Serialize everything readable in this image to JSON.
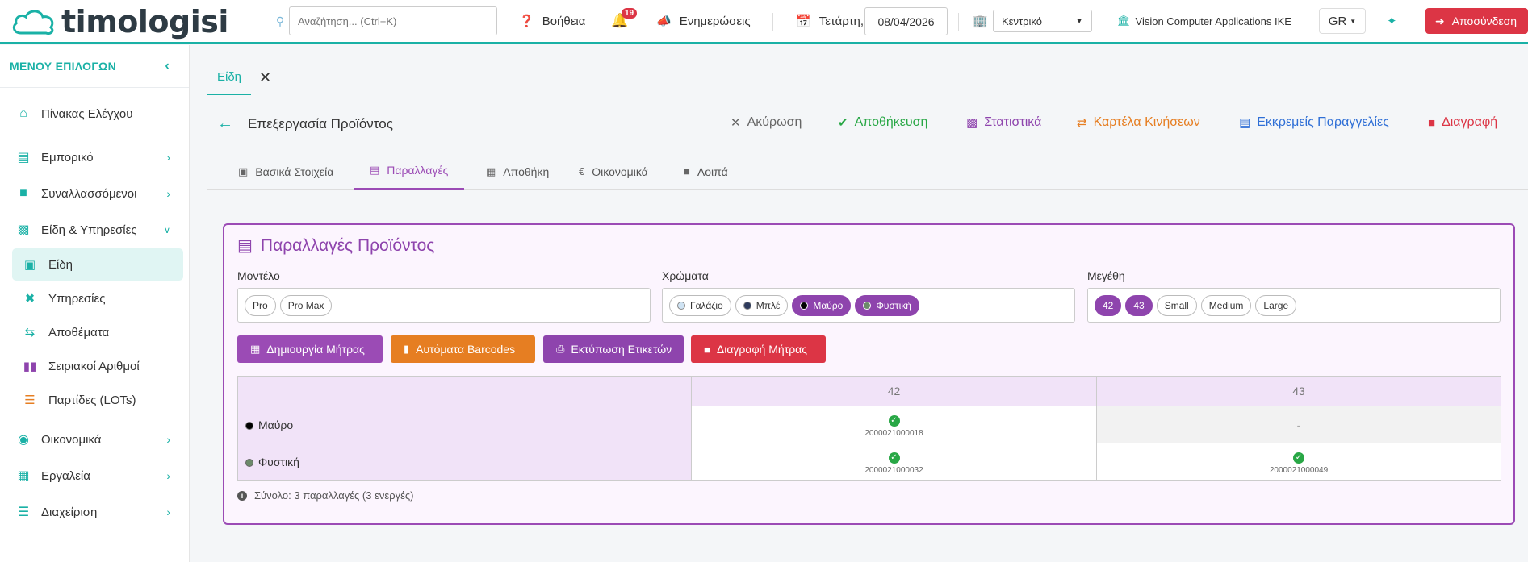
{
  "brand": {
    "name": "timologisi",
    "accent": "#1ab1a6"
  },
  "topbar": {
    "search_placeholder": "Αναζήτηση... (Ctrl+K)",
    "help": "Βοήθεια",
    "notifications_count": "19",
    "updates": "Ενημερώσεις",
    "day": "Τετάρτη,",
    "date": "08/04/2026",
    "branch": "Κεντρικό",
    "company": "Vision Computer Applications IKE",
    "lang": "GR",
    "logout": "Αποσύνδεση"
  },
  "sidebar": {
    "header": "ΜΕΝΟΥ ΕΠΙΛΟΓΩΝ",
    "items": [
      {
        "label": "Πίνακας Ελέγχου",
        "icon": "home-icon"
      },
      {
        "label": "Εμπορικό",
        "icon": "cash-icon"
      },
      {
        "label": "Συναλλασσόμενοι",
        "icon": "contact-icon"
      },
      {
        "label": "Είδη & Υπηρεσίες",
        "icon": "boxes-icon"
      },
      {
        "label": "Οικονομικά",
        "icon": "coins-icon"
      },
      {
        "label": "Εργαλεία",
        "icon": "toolbox-icon"
      },
      {
        "label": "Διαχείριση",
        "icon": "sliders-icon"
      }
    ],
    "sub_items": [
      {
        "label": "Είδη",
        "icon": "box-icon"
      },
      {
        "label": "Υπηρεσίες",
        "icon": "tools-icon"
      },
      {
        "label": "Αποθέματα",
        "icon": "exchange-icon"
      },
      {
        "label": "Σειριακοί Αριθμοί",
        "icon": "barcode-icon"
      },
      {
        "label": "Παρτίδες (LOTs)",
        "icon": "layers-icon"
      }
    ]
  },
  "tab": {
    "label": "Είδη"
  },
  "page": {
    "title": "Επεξεργασία Προϊόντος",
    "actions": {
      "cancel": "Ακύρωση",
      "save": "Αποθήκευση",
      "stats": "Στατιστικά",
      "movements": "Καρτέλα Κινήσεων",
      "pending": "Εκκρεμείς Παραγγελίες",
      "delete": "Διαγραφή"
    }
  },
  "subtabs": [
    "Βασικά Στοιχεία",
    "Παραλλαγές",
    "Αποθήκη",
    "Οικονομικά",
    "Λοιπά"
  ],
  "variants": {
    "title": "Παραλλαγές Προϊόντος",
    "model_label": "Μοντέλο",
    "models": [
      {
        "label": "Pro",
        "selected": false
      },
      {
        "label": "Pro Max",
        "selected": false
      }
    ],
    "colors_label": "Χρώματα",
    "colors": [
      {
        "label": "Γαλάζιο",
        "swatch": "#cfe3f3",
        "selected": false
      },
      {
        "label": "Μπλέ",
        "swatch": "#2d3a5c",
        "selected": false
      },
      {
        "label": "Μαύρο",
        "swatch": "#000000",
        "selected": true
      },
      {
        "label": "Φυστική",
        "swatch": "#6c8a6a",
        "selected": true
      }
    ],
    "sizes_label": "Μεγέθη",
    "sizes": [
      {
        "label": "42",
        "selected": true
      },
      {
        "label": "43",
        "selected": true
      },
      {
        "label": "Small",
        "selected": false
      },
      {
        "label": "Medium",
        "selected": false
      },
      {
        "label": "Large",
        "selected": false
      }
    ],
    "buttons": {
      "create_matrix": "Δημιουργία Μήτρας",
      "auto_barcodes": "Αυτόματα Barcodes",
      "print_labels": "Εκτύπωση Ετικετών",
      "delete_matrix": "Διαγραφή Μήτρας"
    },
    "matrix": {
      "columns": [
        "42",
        "43"
      ],
      "rows": [
        {
          "label": "Μαύρο",
          "swatch": "#000000",
          "cells": [
            "2000021000018",
            "-"
          ]
        },
        {
          "label": "Φυστική",
          "swatch": "#6c8a6a",
          "cells": [
            "2000021000032",
            "2000021000049"
          ]
        }
      ]
    },
    "summary": "Σύνολο: 3 παραλλαγές (3 ενεργές)"
  }
}
